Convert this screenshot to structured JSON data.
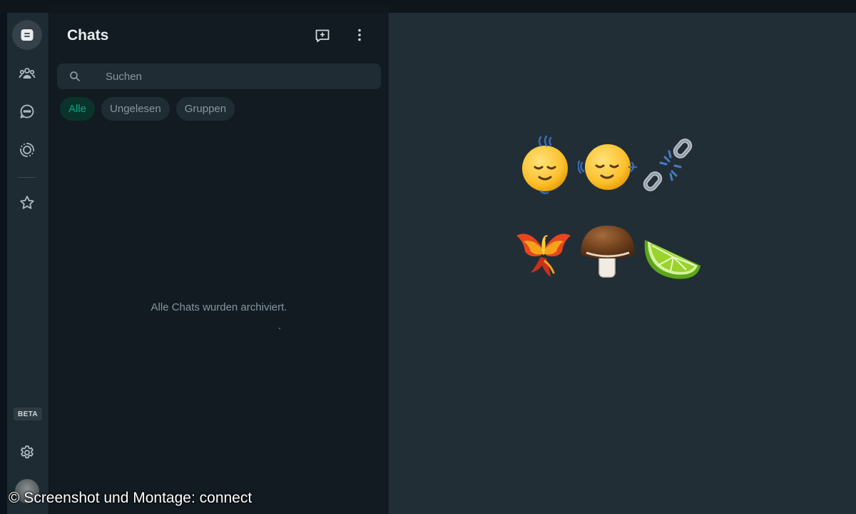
{
  "sidebar": {
    "icons": [
      "chats-icon",
      "communities-icon",
      "channels-icon",
      "status-icon",
      "starred-icon",
      "settings-icon"
    ],
    "beta_label": "BETA"
  },
  "panel": {
    "title": "Chats",
    "search_placeholder": "Suchen",
    "filters": [
      {
        "label": "Alle",
        "active": true
      },
      {
        "label": "Ungelesen",
        "active": false
      },
      {
        "label": "Gruppen",
        "active": false
      }
    ],
    "empty_message": "Alle Chats wurden archiviert."
  },
  "main": {
    "emojis": [
      {
        "name": "face-shaking-vertically"
      },
      {
        "name": "face-shaking-horizontally"
      },
      {
        "name": "broken-chain"
      },
      {
        "name": "phoenix"
      },
      {
        "name": "brown-mushroom"
      },
      {
        "name": "lime"
      }
    ]
  },
  "watermark": "© Screenshot und Montage: connect",
  "colors": {
    "accent": "#00a884",
    "panel_bg": "#111b21",
    "main_bg": "#222e35",
    "rail_bg": "#1f2b32"
  }
}
